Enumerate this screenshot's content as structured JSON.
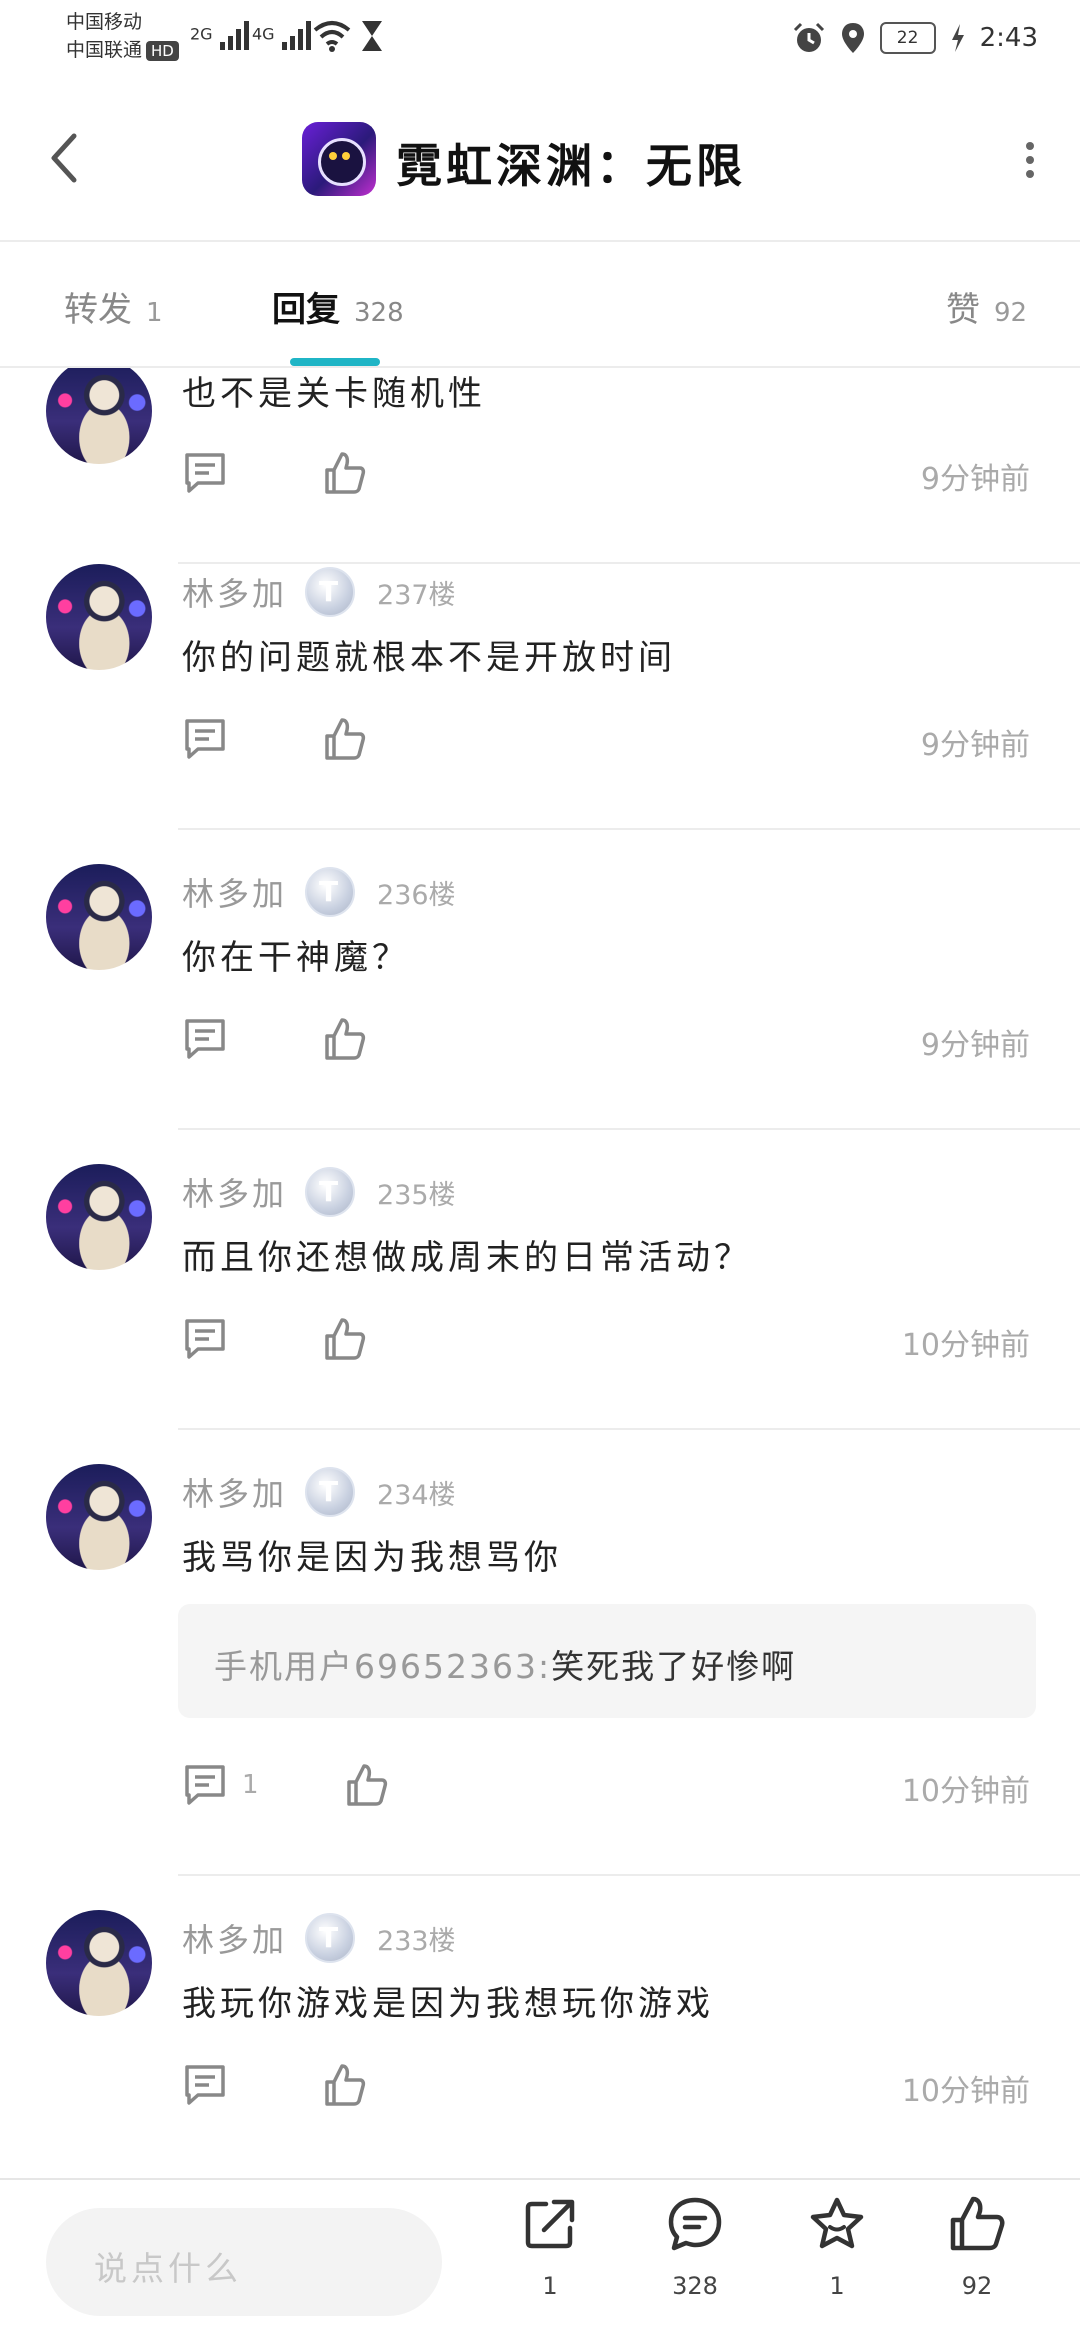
{
  "status_bar": {
    "carrier1": "中国移动",
    "carrier2": "中国联通",
    "hd": "HD",
    "signal1": "2G",
    "signal2": "4G",
    "battery": "22",
    "time": "2:43"
  },
  "header": {
    "title": "霓虹深渊：无限"
  },
  "tabs": {
    "forward_label": "转发",
    "forward_count": "1",
    "reply_label": "回复",
    "reply_count": "328",
    "like_label": "赞",
    "like_count": "92"
  },
  "posts": [
    {
      "text": "也不是关卡随机性",
      "time": "9分钟前"
    },
    {
      "username": "林多加",
      "floor": "237楼",
      "text": "你的问题就根本不是开放时间",
      "time": "9分钟前"
    },
    {
      "username": "林多加",
      "floor": "236楼",
      "text": "你在干神魔？",
      "time": "9分钟前"
    },
    {
      "username": "林多加",
      "floor": "235楼",
      "text": "而且你还想做成周末的日常活动？",
      "time": "10分钟前"
    },
    {
      "username": "林多加",
      "floor": "234楼",
      "text": "我骂你是因为我想骂你",
      "quote_user": "手机用户69652363:",
      "quote_text": "笑死我了好惨啊",
      "reply_count": "1",
      "time": "10分钟前"
    },
    {
      "username": "林多加",
      "floor": "233楼",
      "text": "我玩你游戏是因为我想玩你游戏",
      "time": "10分钟前"
    }
  ],
  "bottom_bar": {
    "input_placeholder": "说点什么",
    "share_count": "1",
    "comment_count": "328",
    "favorite_count": "1",
    "like_count": "92"
  },
  "icons": {
    "back": "chevron-left-icon",
    "more": "more-vertical-icon",
    "reply": "comment-icon",
    "like": "thumbs-up-icon",
    "share": "share-icon",
    "favorite": "star-icon"
  },
  "colors": {
    "accent": "#1fb5c6"
  }
}
